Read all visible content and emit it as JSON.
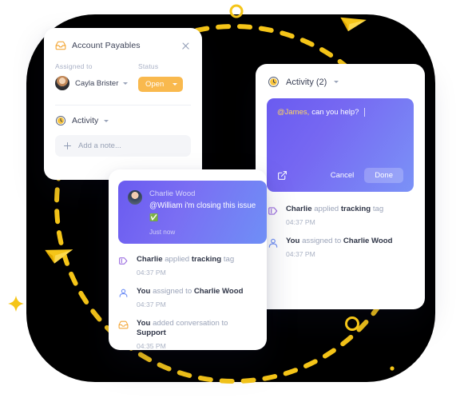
{
  "theme": {
    "accent_yellow": "#f9b94e",
    "accent_purple": "#6a5bf0",
    "decor_yellow": "#f5c518",
    "backdrop_black": "#000000",
    "tag_icon_purple": "#9b6ce0",
    "person_icon_blue": "#6f8ff6",
    "inbox_icon_orange": "#f4a93c",
    "mention_yellow": "#ffd75e"
  },
  "ticket_card": {
    "icon": "inbox-icon",
    "title": "Account Payables",
    "close_icon": "close-icon",
    "assigned": {
      "label": "Assigned to",
      "avatar": "user-avatar",
      "name": "Cayla Brister",
      "chevron": "chevron-down-icon"
    },
    "status": {
      "label": "Status",
      "value": "Open",
      "chevron": "chevron-down-icon"
    },
    "activity": {
      "icon": "clock-icon",
      "title": "Activity",
      "chevron": "chevron-down-icon"
    },
    "note": {
      "plus_icon": "plus-icon",
      "placeholder": "Add a note..."
    }
  },
  "mid_activity_card": {
    "comment": {
      "avatar": "user-avatar",
      "author": "Charlie Wood",
      "text_prefix": "@William",
      "text": "@William i'm closing this issue",
      "emoji": "✅",
      "time": "Just now"
    },
    "feed": [
      {
        "icon": "tag-icon",
        "actor": "Charlie",
        "verb": "applied",
        "object": "tracking",
        "suffix": "tag",
        "time": "04:37 PM"
      },
      {
        "icon": "person-icon",
        "actor": "You",
        "verb": "assigned to",
        "object": "Charlie Wood",
        "suffix": "",
        "time": "04:37 PM"
      },
      {
        "icon": "inbox-icon",
        "actor": "You",
        "verb": "added conversation to",
        "object": "Support",
        "suffix": "",
        "time": "04:35 PM"
      }
    ]
  },
  "right_activity_card": {
    "header": {
      "icon": "clock-icon",
      "title": "Activity (2)",
      "chevron": "chevron-down-icon"
    },
    "composer": {
      "mention": "@James,",
      "rest": "can you help?",
      "expand_icon": "expand-icon",
      "cancel_label": "Cancel",
      "done_label": "Done"
    },
    "feed": [
      {
        "icon": "tag-icon",
        "actor": "Charlie",
        "verb": "applied",
        "object": "tracking",
        "suffix": "tag",
        "time": "04:37 PM"
      },
      {
        "icon": "person-icon",
        "actor": "You",
        "verb": "assigned to",
        "object": "Charlie Wood",
        "suffix": "",
        "time": "04:37 PM"
      }
    ]
  },
  "decorations": {
    "dashed_circle": "dashed-circle",
    "paper_plane_top": "paper-plane-icon",
    "paper_plane_left": "paper-plane-icon",
    "ring_top": "ring-shape",
    "ring_bottom": "ring-shape",
    "sparkle": "sparkle-icon",
    "dot": "dot-shape"
  }
}
